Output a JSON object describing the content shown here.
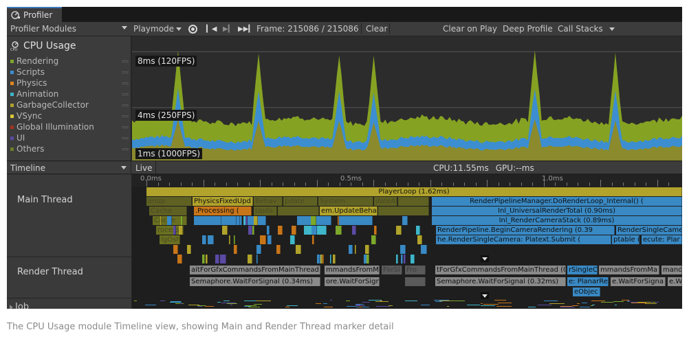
{
  "window": {
    "tab_title": "Profiler"
  },
  "toolbar": {
    "modules_label": "Profiler Modules",
    "target_label": "Playmode",
    "frame_label": "Frame: 215086 / 215086",
    "clear_label": "Clear",
    "clear_on_play_label": "Clear on Play",
    "deep_profile_label": "Deep Profile",
    "call_stacks_label": "Call Stacks"
  },
  "module": {
    "title": "CPU Usage",
    "legend": [
      {
        "label": "Rendering",
        "color": "#7da82b"
      },
      {
        "label": "Scripts",
        "color": "#3c8ed1"
      },
      {
        "label": "Physics",
        "color": "#e0871c"
      },
      {
        "label": "Animation",
        "color": "#3fb6c9"
      },
      {
        "label": "GarbageCollector",
        "color": "#b0a22e"
      },
      {
        "label": "VSync",
        "color": "#d9c83a"
      },
      {
        "label": "Global Illumination",
        "color": "#a1331d"
      },
      {
        "label": "UI",
        "color": "#5b4aa3"
      },
      {
        "label": "Others",
        "color": "#6b7d26"
      }
    ]
  },
  "chart_data": {
    "type": "area",
    "y_gridlines": [
      {
        "label": "8ms (120FPS)",
        "value_ms": 8.33
      },
      {
        "label": "4ms (250FPS)",
        "value_ms": 4.0
      },
      {
        "label": "1ms (1000FPS)",
        "value_ms": 1.0
      }
    ],
    "series": [
      {
        "name": "Others",
        "color": "#8aa12f"
      },
      {
        "name": "Rendering",
        "color": "#7da82b"
      },
      {
        "name": "Scripts",
        "color": "#3c8ed1"
      }
    ],
    "spike_frame_indices": [
      20,
      55,
      90,
      105,
      175,
      210
    ],
    "baseline_ms": {
      "others": 0.9,
      "scripts": 1.55,
      "rendering": 3.0
    }
  },
  "timeline": {
    "view_label": "Timeline",
    "live_label": "Live",
    "cpu_label": "CPU:11.55ms",
    "gpu_label": "GPU:--ms",
    "ruler": [
      "0.0ms",
      "0.5ms",
      "1.0ms"
    ],
    "threads": {
      "main": "Main Thread",
      "render": "Render Thread",
      "job": "Job"
    },
    "main_markers": {
      "playerloop": "PlayerLoop (1.62ms)",
      "fixed_update": "PhysicsFixedUpd",
      "do_render_loop": "RenderPipelineManager.DoRenderLoop_Internal() (",
      "processing": ".Processing (",
      "behaviour": "em.UpdateBehav",
      "universal_render_total": "Inl_UniversalRenderTotal (0.90ms)",
      "camera_stack": "Inl_RenderCameraStack (0.89ms)",
      "begin_camera": "RenderPipeline.BeginCameraRendering (0.39",
      "render_single_camera": "RenderSingleCamera",
      "single_camera_submit": "he.RenderSingleCamera: Platext.Submit (",
      "submit_tail": "ptable (",
      "execute_tail": "ecute: Plar",
      "ghost_upd": "upd",
      "ghost_upda": "Upda",
      "ghost_system": "System",
      "ghost_behav": "Behav",
      "ghost_pdate": "pdate",
      "ghost_dateal": "dateAl",
      "ghost_cache": "Cache",
      "ghost_nup": "anup",
      "ghost_cache2": "Cache",
      "ghost_rocess": "rocess",
      "ghost_gosh": "IgOsh",
      "ghost_update": "em.Update",
      "ghost_behaviour": "urUpd"
    },
    "render_markers": {
      "wait_gfx_1": "aitForGfxCommandsFromMainThread (0.",
      "commands_1": "mmandsFromMai",
      "wait_gfx_2": "tForGfxCommandsFromMainThread (0",
      "single_cam_1": "rSingleCam",
      "commands_2": "mmandsFromMa",
      "command_tail": "mand",
      "wait_signal_1": "Semaphore.WaitForSignal (0.34ms)",
      "wait_signal_2": "ore.WaitForSignal",
      "wait_signal_3": "Semaphore.WaitForSignal (0.32ms)",
      "planar_re": "e: PlanarRe",
      "wait_signal_4": "e.WaitForSigna",
      "wait_signal_tail": "e.Wait",
      "object_tail": "eObjec",
      "ghost_sfr": "ForSi",
      "ghost_sfo": "Fro"
    }
  },
  "caption": "The CPU Usage module Timeline view, showing Main and Render Thread marker detail"
}
